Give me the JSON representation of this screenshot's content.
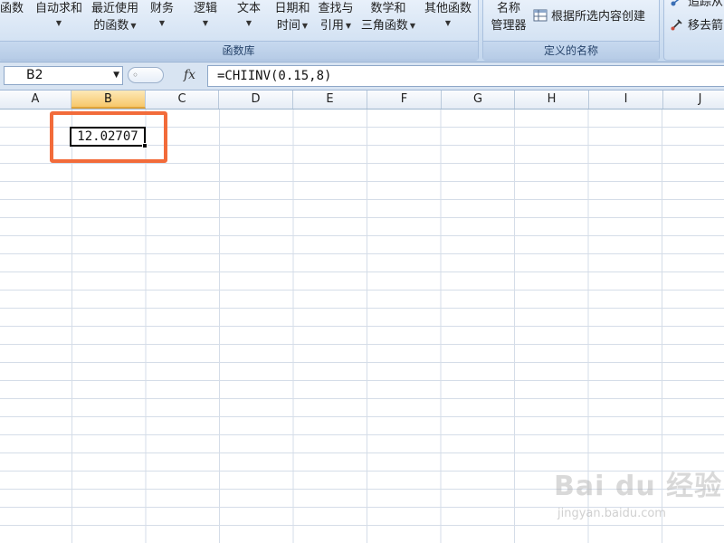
{
  "ribbon": {
    "function_library": {
      "label": "函数库",
      "buttons": [
        {
          "name": "insert-function",
          "lines": [
            "函数"
          ],
          "chevron": false
        },
        {
          "name": "autosum",
          "lines": [
            "自动求和"
          ],
          "chevron": true
        },
        {
          "name": "recent",
          "lines": [
            "最近使用",
            "的函数"
          ],
          "chevron": true
        },
        {
          "name": "financial",
          "lines": [
            "财务"
          ],
          "chevron": true
        },
        {
          "name": "logical",
          "lines": [
            "逻辑"
          ],
          "chevron": true
        },
        {
          "name": "text",
          "lines": [
            "文本"
          ],
          "chevron": true
        },
        {
          "name": "datetime",
          "lines": [
            "日期和",
            "时间"
          ],
          "chevron": true
        },
        {
          "name": "lookup",
          "lines": [
            "查找与",
            "引用"
          ],
          "chevron": true
        },
        {
          "name": "math",
          "lines": [
            "数学和",
            "三角函数"
          ],
          "chevron": true
        },
        {
          "name": "more",
          "lines": [
            "其他函数"
          ],
          "chevron": true
        }
      ]
    },
    "defined_names": {
      "label": "定义的名称",
      "name_manager": [
        "名称",
        "管理器"
      ],
      "create_from_selection": "根据所选内容创建"
    },
    "formula_auditing": {
      "trace": "追踪从",
      "remove_arrows": "移去箭"
    }
  },
  "formula_bar": {
    "name_box": "B2",
    "fx": "fx",
    "formula": "=CHIINV(0.15,8)"
  },
  "sheet": {
    "columns": [
      "A",
      "B",
      "C",
      "D",
      "E",
      "F",
      "G",
      "H",
      "I",
      "J"
    ],
    "active_column": "B",
    "active_cell": {
      "ref": "B2",
      "value": "12.02707"
    }
  },
  "watermark": {
    "brand": "Bai du 经验",
    "url": "jingyan.baidu.com"
  }
}
